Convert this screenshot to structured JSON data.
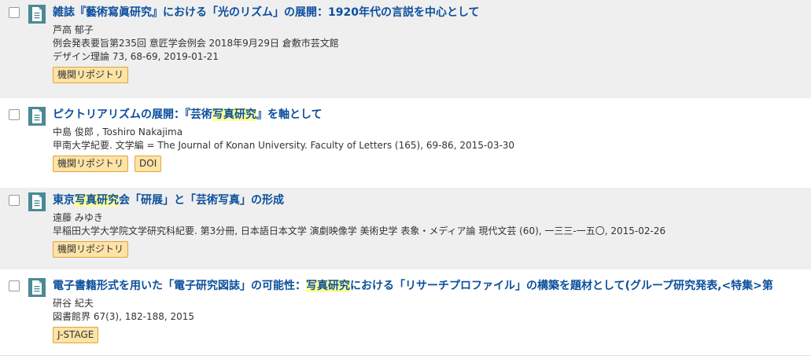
{
  "results": [
    {
      "title_parts": [
        "雑誌『藝術寫眞研究』における「光のリズム」の展開：1920年代の言説を中心として",
        "",
        ""
      ],
      "lines": [
        "芦高 郁子",
        "例会発表要旨第235回 意匠学会例会 2018年9月29日 倉敷市芸文館",
        "デザイン理論 73, 68-69, 2019-01-21"
      ],
      "tags": [
        "機関リポジトリ",
        ""
      ]
    },
    {
      "title_parts": [
        "ピクトリアリズムの展開：『芸術",
        "写真研究",
        "』を軸として"
      ],
      "lines": [
        "中島 俊郎 , Toshiro Nakajima",
        "甲南大学紀要. 文学編 = The Journal of Konan University. Faculty of Letters (165), 69-86, 2015-03-30",
        ""
      ],
      "tags": [
        "機関リポジトリ",
        "DOI"
      ]
    },
    {
      "title_parts": [
        "東京",
        "写真研究",
        "会「研展」と「芸術写真」の形成"
      ],
      "lines": [
        "遠藤 みゆき",
        "早稲田大学大学院文学研究科紀要. 第3分冊, 日本語日本文学 演劇映像学 美術史学 表象・メディア論 現代文芸 (60), 一三三-一五〇, 2015-02-26",
        ""
      ],
      "tags": [
        "機関リポジトリ",
        ""
      ]
    },
    {
      "title_parts": [
        "電子書籍形式を用いた「電子研究図誌」の可能性：",
        "写真研究",
        "における「リサーチプロファイル」の構築を題材として(グループ研究発表,<特集>第"
      ],
      "lines": [
        "研谷 紀夫",
        "図書館界 67(3), 182-188, 2015",
        ""
      ],
      "tags": [
        "J-STAGE",
        ""
      ]
    }
  ],
  "icons": {
    "checkbox": "checkbox-icon",
    "document": "document-icon"
  },
  "colors": {
    "title": "#0b4f9c",
    "highlight": "#ffff99",
    "tag_bg": "#fde3a6",
    "tag_border": "#e0a43a",
    "row_bg": "#efefef"
  }
}
